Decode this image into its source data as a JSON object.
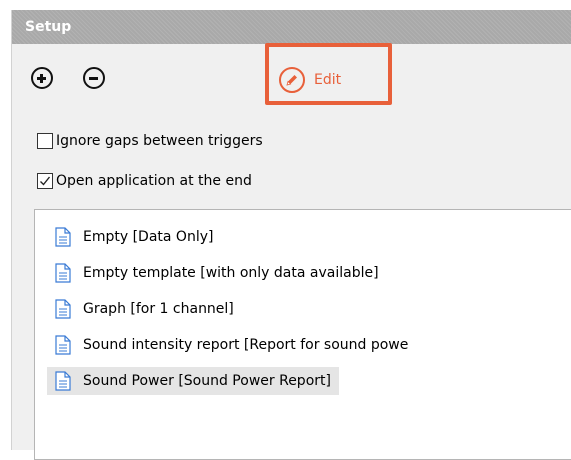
{
  "panel": {
    "title": "Setup"
  },
  "toolbar": {
    "add_icon": "plus-circle-icon",
    "remove_icon": "minus-circle-icon",
    "edit_icon": "pencil-circle-icon",
    "edit_label": "Edit",
    "highlight_color": "#e8603a"
  },
  "options": {
    "ignore_gaps": {
      "label": "Ignore gaps between triggers",
      "checked": false
    },
    "open_app": {
      "label": "Open application at the end",
      "checked": true
    }
  },
  "templates": {
    "icon": "document-icon",
    "items": [
      {
        "label": "Empty [Data Only]",
        "selected": false
      },
      {
        "label": "Empty template [with only data available]",
        "selected": false
      },
      {
        "label": "Graph [for 1 channel]",
        "selected": false
      },
      {
        "label": "Sound intensity report [Report for sound powe",
        "selected": false
      },
      {
        "label": "Sound Power [Sound Power Report]",
        "selected": true
      }
    ]
  }
}
